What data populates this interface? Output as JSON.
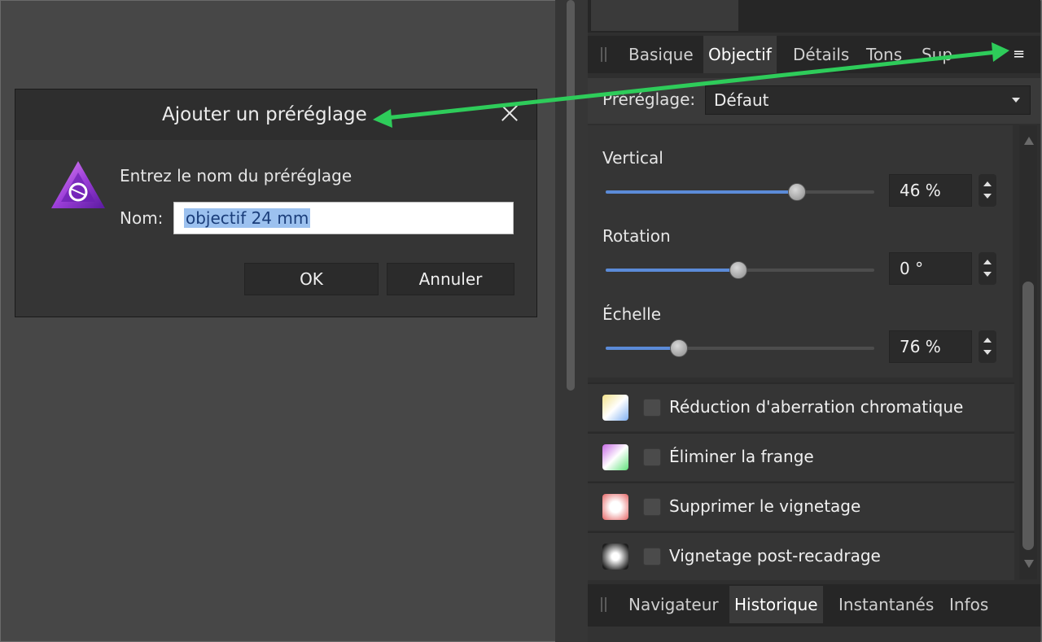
{
  "panel": {
    "tabs": [
      "Basique",
      "Objectif",
      "Détails",
      "Tons",
      "Sup"
    ],
    "active_tab": "Objectif",
    "menu_icon": "hamburger-menu-icon",
    "preset": {
      "label": "Préréglage:",
      "value": "Défaut"
    },
    "sliders": [
      {
        "name": "Vertical",
        "value_text": "46 %",
        "fill": 0.71
      },
      {
        "name": "Rotation",
        "value_text": "0 °",
        "fill": 0.49
      },
      {
        "name": "Échelle",
        "value_text": "76 %",
        "fill": 0.27
      }
    ],
    "features": [
      {
        "label": "Réduction d'aberration chromatique",
        "icon": "chromatic-aberration-icon",
        "checked": false
      },
      {
        "label": "Éliminer la frange",
        "icon": "defringe-icon",
        "checked": false
      },
      {
        "label": "Supprimer le vignetage",
        "icon": "vignette-removal-icon",
        "checked": false
      },
      {
        "label": "Vignetage post-recadrage",
        "icon": "post-crop-vignette-icon",
        "checked": false
      }
    ]
  },
  "bottom_panel": {
    "tabs": [
      "Navigateur",
      "Historique",
      "Instantanés",
      "Infos"
    ],
    "active_tab": "Historique"
  },
  "dialog": {
    "title": "Ajouter un préréglage",
    "prompt": "Entrez le nom du préréglage",
    "name_label": "Nom:",
    "name_value": "objectif 24 mm",
    "ok_label": "OK",
    "cancel_label": "Annuler",
    "logo_icon": "affinity-photo-logo-icon"
  },
  "annotation": {
    "arrow_color": "#2ecc5a"
  },
  "colors": {
    "accent": "#5b8bd8",
    "panel_bg": "#2f2f2f",
    "selection": "#9cc1ef"
  }
}
